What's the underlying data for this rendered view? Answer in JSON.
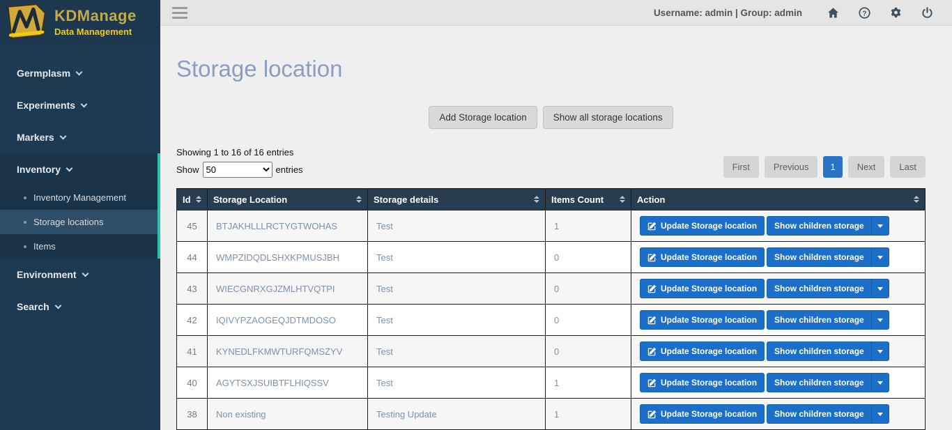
{
  "brand": {
    "title": "KDManage",
    "subtitle": "Data Management"
  },
  "topbar": {
    "user_info": "Username: admin | Group: admin"
  },
  "sidebar": {
    "germplasm": "Germplasm",
    "experiments": "Experiments",
    "markers": "Markers",
    "inventory": "Inventory",
    "inventory_children": {
      "management": "Inventory Management",
      "storage": "Storage locations",
      "items": "Items"
    },
    "environment": "Environment",
    "search": "Search"
  },
  "page": {
    "title": "Storage location",
    "add_button": "Add Storage location",
    "show_all_button": "Show all storage locations",
    "showing_text": "Showing 1 to 16 of 16 entries",
    "show_label": "Show",
    "entries_label": "entries",
    "page_size": "50"
  },
  "pagination": {
    "first": "First",
    "previous": "Previous",
    "current": "1",
    "next": "Next",
    "last": "Last"
  },
  "table": {
    "headers": [
      "Id",
      "Storage Location",
      "Storage details",
      "Items Count",
      "Action"
    ],
    "buttons": {
      "update": "Update Storage location",
      "children": "Show children storage"
    },
    "rows": [
      {
        "id": "45",
        "location": "BTJAKHLLLRCTYGTWOHAS",
        "details": "Test",
        "count": "1"
      },
      {
        "id": "44",
        "location": "WMPZIDQDLSHXKPMUSJBH",
        "details": "Test",
        "count": "0"
      },
      {
        "id": "43",
        "location": "WIECGNRXGJZMLHTVQTPI",
        "details": "Test",
        "count": "0"
      },
      {
        "id": "42",
        "location": "IQIVYPZAOGEQJDTMDOSO",
        "details": "Test",
        "count": "0"
      },
      {
        "id": "41",
        "location": "KYNEDLFKMWTURFQMSZYV",
        "details": "Test",
        "count": "0"
      },
      {
        "id": "40",
        "location": "AGYTSXJSUIBTFLHIQSSV",
        "details": "Test",
        "count": "1"
      },
      {
        "id": "38",
        "location": "Non existing",
        "details": "Testing Update",
        "count": "1"
      }
    ]
  },
  "colors": {
    "sidebar_bg": "#1e3a52",
    "teal_accent": "#2fc0b0",
    "action_blue": "#1b6fc9",
    "table_header_bg": "#263d52",
    "title_text": "#8b9dc0",
    "brand_gold": "#c3aa4e",
    "brand_yellow": "#f2cc0c"
  }
}
